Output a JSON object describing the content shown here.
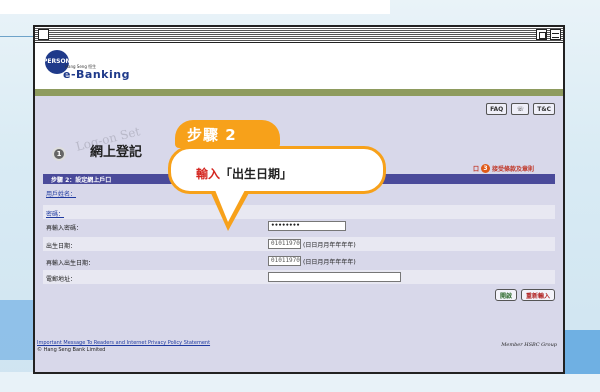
{
  "brand": {
    "personal": "PERSONAL",
    "hang_seng": "Hang Seng 恒生",
    "ebanking": "e-Banking"
  },
  "top_buttons": [
    "FAQ",
    "☏",
    "T&C"
  ],
  "page": {
    "step_number": "1",
    "ghost_text": "Log-on Set",
    "title": "網上登記"
  },
  "steps_legend": {
    "current": "口",
    "next_num": "3",
    "next_label": "接受條款及章則"
  },
  "step_bar": "步驟 2：設定網上戶口",
  "form": {
    "username_label": "用戶姓名：",
    "password_label": "密碼：",
    "password_confirm_label": "再輸入密碼：",
    "password_confirm_value": "••••••••",
    "dob_label": "出生日期：",
    "dob_value": "01011970",
    "dob_hint": "(日日月月年年年年)",
    "dob_confirm_label": "再輸入出生日期：",
    "dob_confirm_value": "01011970",
    "dob_confirm_hint": "(日日月月年年年年)",
    "email_label": "電郵地址："
  },
  "actions": {
    "back": "開啟",
    "reset": "重新輸入"
  },
  "footer": {
    "links": "Important Message To Readers and Internet Privacy Policy Statement",
    "copyright": "© Hang Seng Bank Limited",
    "member": "Member HSBC Group"
  },
  "callout": {
    "step_tag": "步驟 2",
    "prefix": "輸入",
    "text": "「出生日期」"
  },
  "colors": {
    "callout_orange": "#f7a11a",
    "step_bar": "#4a4a9a",
    "page_bg": "#d8d8ea"
  }
}
